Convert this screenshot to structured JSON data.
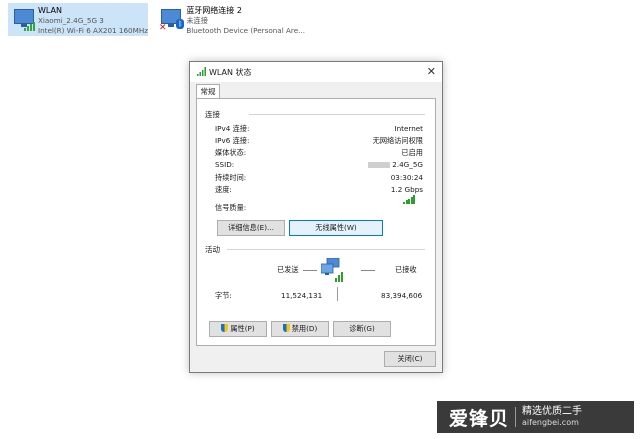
{
  "adapters": [
    {
      "name": "WLAN",
      "network": "Xiaomi_2.4G_5G 3",
      "device": "Intel(R) Wi-Fi 6 AX201 160MHz",
      "icon": "wifi-adapter-icon"
    },
    {
      "name": "蓝牙网络连接 2",
      "network": "未连接",
      "device": "Bluetooth Device (Personal Are...",
      "icon": "bluetooth-adapter-icon"
    }
  ],
  "dialog": {
    "title": "WLAN 状态",
    "tab": "常规",
    "connection_header": "连接",
    "rows": [
      {
        "label": "IPv4 连接:",
        "value": "Internet"
      },
      {
        "label": "IPv6 连接:",
        "value": "无网络访问权限"
      },
      {
        "label": "媒体状态:",
        "value": "已启用"
      },
      {
        "label": "SSID:",
        "value": "2.4G_5G"
      },
      {
        "label": "持续时间:",
        "value": "03:30:24"
      },
      {
        "label": "速度:",
        "value": "1.2 Gbps"
      }
    ],
    "signal_label": "信号质量:",
    "signal_bars": 5,
    "details_button": "详细信息(E)...",
    "wireless_button": "无线属性(W)",
    "activity_header": "活动",
    "sent_label": "已发送",
    "received_label": "已接收",
    "bytes_label": "字节:",
    "bytes_sent": "11,524,131",
    "bytes_received": "83,394,606",
    "properties_button": "属性(P)",
    "disable_button": "禁用(D)",
    "diagnose_button": "诊断(G)",
    "close_button": "关闭(C)"
  },
  "watermark": {
    "brand": "爱锋贝",
    "slogan": "精选优质二手",
    "url": "aifengbei.com"
  },
  "colors": {
    "selection": "#cce4f7",
    "signal": "#2f9e2f",
    "accent": "#0078d7"
  }
}
